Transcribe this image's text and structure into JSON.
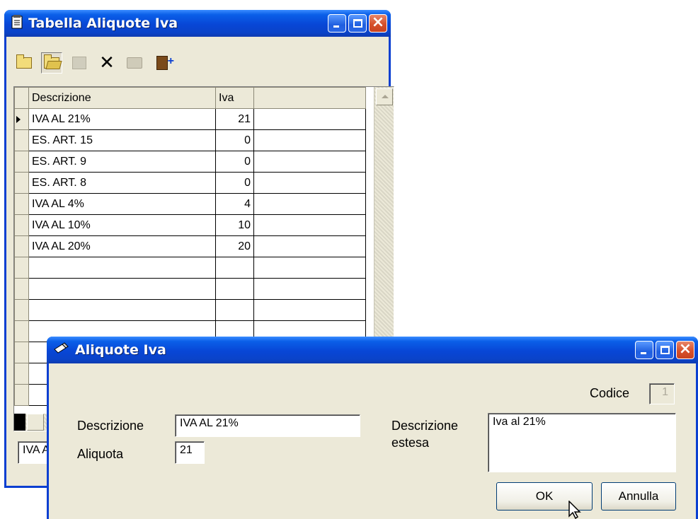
{
  "main_window": {
    "title": "Tabella Aliquote Iva",
    "toolbar": [
      "new-folder-icon",
      "open-folder-icon",
      "disabled-record-icon",
      "delete-icon",
      "print-icon",
      "exit-icon"
    ],
    "columns": [
      "Descrizione",
      "Iva"
    ],
    "rows": [
      {
        "descrizione": "IVA AL 21%",
        "iva": "21"
      },
      {
        "descrizione": "ES. ART. 15",
        "iva": "0"
      },
      {
        "descrizione": "ES. ART. 9",
        "iva": "0"
      },
      {
        "descrizione": "ES. ART. 8",
        "iva": "0"
      },
      {
        "descrizione": "IVA AL 4%",
        "iva": "4"
      },
      {
        "descrizione": "IVA AL 10%",
        "iva": "10"
      },
      {
        "descrizione": "IVA AL 20%",
        "iva": "20"
      }
    ],
    "status_value": "IVA AL 21%"
  },
  "dialog": {
    "title": "Aliquote Iva",
    "codice_label": "Codice",
    "codice_value": "1",
    "descrizione_label": "Descrizione",
    "descrizione_value": "IVA AL 21%",
    "aliquota_label": "Aliquota",
    "aliquota_value": "21",
    "estesa_label_1": "Descrizione",
    "estesa_label_2": "estesa",
    "estesa_value": "Iva al 21%",
    "ok_label": "OK",
    "cancel_label": "Annulla"
  },
  "colors": {
    "title_blue": "#0a3fd1",
    "window_face": "#ece9d8",
    "close_red": "#d6502b"
  }
}
